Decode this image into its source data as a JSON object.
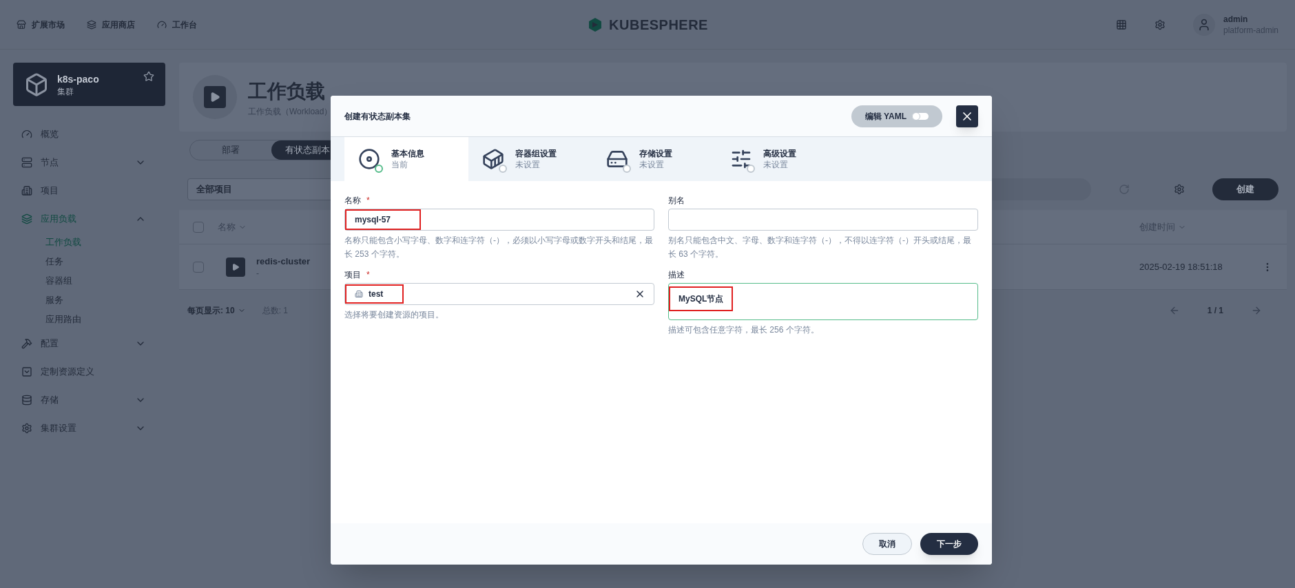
{
  "top_nav": {
    "links": [
      {
        "label": "扩展市场"
      },
      {
        "label": "应用商店"
      },
      {
        "label": "工作台"
      }
    ],
    "logo": "KUBESPHERE",
    "user": {
      "name": "admin",
      "role": "platform-admin"
    }
  },
  "sidebar": {
    "cluster": {
      "name": "k8s-paco",
      "type": "集群"
    },
    "items": [
      {
        "label": "概览",
        "kind": "link",
        "selected": false
      },
      {
        "label": "节点",
        "kind": "group",
        "selected": false,
        "expanded": false
      },
      {
        "label": "项目",
        "kind": "link",
        "selected": false
      },
      {
        "label": "应用负载",
        "kind": "group",
        "selected": true,
        "expanded": true,
        "children": [
          {
            "label": "工作负载",
            "selected": true
          },
          {
            "label": "任务",
            "selected": false
          },
          {
            "label": "容器组",
            "selected": false
          },
          {
            "label": "服务",
            "selected": false
          },
          {
            "label": "应用路由",
            "selected": false
          }
        ]
      },
      {
        "label": "配置",
        "kind": "group",
        "selected": false,
        "expanded": false
      },
      {
        "label": "定制资源定义",
        "kind": "link",
        "selected": false
      },
      {
        "label": "存储",
        "kind": "group",
        "selected": false,
        "expanded": false
      },
      {
        "label": "集群设置",
        "kind": "group",
        "selected": false,
        "expanded": false
      }
    ]
  },
  "page": {
    "title": "工作负载",
    "description": "工作负载（Workload）",
    "tabs": [
      {
        "label": "部署",
        "selected": false
      },
      {
        "label": "有状态副本",
        "selected": true
      }
    ],
    "filter": {
      "project": "全部项目"
    },
    "create_button": "创建",
    "table": {
      "select_all": {
        "checked": false
      },
      "columns": [
        {
          "label": "名称"
        },
        {
          "label": "创建时间"
        }
      ],
      "rows": [
        {
          "checked": false,
          "name": "redis-cluster",
          "sub": "-",
          "created": "2025-02-19 18:51:18"
        }
      ]
    },
    "footer": {
      "page_size_label": "每页显示: 10",
      "total": "总数: 1",
      "pages": "1 / 1"
    }
  },
  "dialog": {
    "title": "创建有状态副本集",
    "yaml_toggle": {
      "label": "编辑 YAML",
      "on": false
    },
    "steps": [
      {
        "title": "基本信息",
        "status": "当前",
        "selected": true
      },
      {
        "title": "容器组设置",
        "status": "未设置",
        "selected": false
      },
      {
        "title": "存储设置",
        "status": "未设置",
        "selected": false
      },
      {
        "title": "高级设置",
        "status": "未设置",
        "selected": false
      }
    ],
    "fields": [
      {
        "label": "名称",
        "required_mark": "*",
        "kind": "input",
        "value": "mysql-57",
        "hint": "名称只能包含小写字母、数字和连字符（-），必须以小写字母或数字开头和结尾，最长 253 个字符。",
        "focused": false
      },
      {
        "label": "别名",
        "kind": "input",
        "hint": "别名只能包含中文、字母、数字和连字符（-），不得以连字符（-）开头或结尾，最长 63 个字符。",
        "focused": false
      },
      {
        "label": "项目",
        "required_mark": "*",
        "kind": "select",
        "value": "test",
        "hint": "选择将要创建资源的项目。",
        "focused": false
      },
      {
        "label": "描述",
        "kind": "textarea",
        "value": "MySQL节点",
        "hint": "描述可包含任意字符，最长 256 个字符。",
        "focused": true
      }
    ],
    "buttons": {
      "cancel": "取消",
      "next": "下一步"
    }
  }
}
